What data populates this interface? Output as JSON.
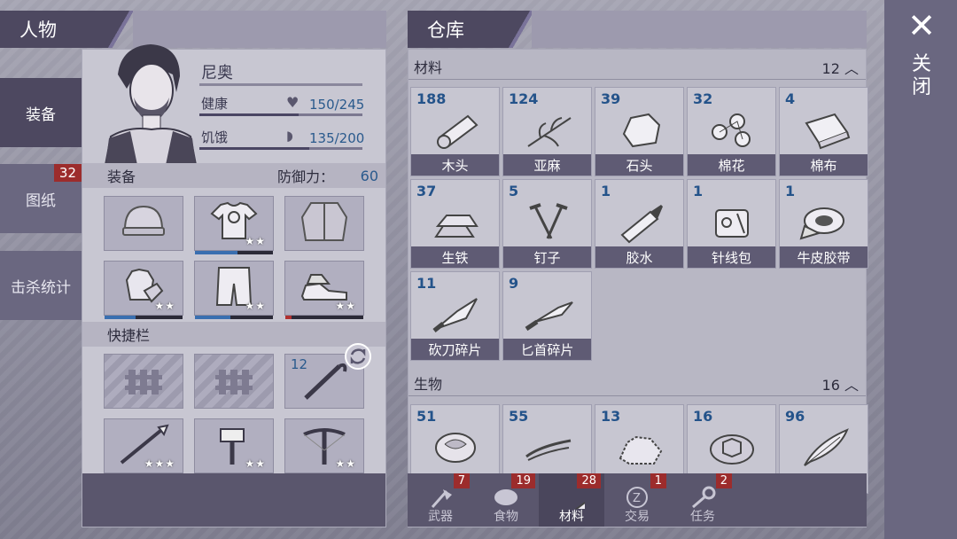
{
  "left_tabs": [
    {
      "label": "装备",
      "active": true
    },
    {
      "label": "图纸",
      "badge": "32"
    },
    {
      "label": "击杀统计"
    }
  ],
  "character": {
    "header": "人物",
    "name": "尼奥",
    "health_label": "健康",
    "health_value": "150/245",
    "health_fraction": 0.61,
    "hunger_label": "饥饿",
    "hunger_value": "135/200",
    "hunger_fraction": 0.675,
    "equipment_label": "装备",
    "defense_label": "防御力：",
    "defense_value": "60",
    "equipment_slots": [
      {
        "icon": "beanie-icon",
        "stars": 0
      },
      {
        "icon": "tshirt-icon",
        "stars": 2,
        "durability": 0.55,
        "dur_color": "#3a6fb0"
      },
      {
        "icon": "jacket-icon",
        "stars": 0
      },
      {
        "icon": "gloves-icon",
        "stars": 2,
        "durability": 0.4,
        "dur_color": "#3a6fb0"
      },
      {
        "icon": "pants-icon",
        "stars": 2,
        "durability": 0.45,
        "dur_color": "#3a6fb0"
      },
      {
        "icon": "sneakers-icon",
        "stars": 2,
        "durability": 0.08,
        "dur_color": "#b03030"
      }
    ],
    "hotbar_label": "快捷栏",
    "hotbar_slots": [
      {
        "icon": "locked-icon",
        "locked": true
      },
      {
        "icon": "locked-icon",
        "locked": true
      },
      {
        "icon": "crowbar-icon",
        "qty": "12"
      },
      {
        "icon": "spear-icon",
        "stars": 3,
        "durability": 0.05,
        "dur_color": "#b03030"
      },
      {
        "icon": "hammer-icon",
        "stars": 2,
        "durability": 0.4,
        "dur_color": "#3a6fb0"
      },
      {
        "icon": "crossbow-icon",
        "stars": 2,
        "durability": 0.15,
        "dur_color": "#b03030"
      }
    ]
  },
  "warehouse": {
    "header": "仓库",
    "materials": {
      "label": "材料",
      "count": "12",
      "items": [
        {
          "qty": "188",
          "name": "木头",
          "icon": "log-icon"
        },
        {
          "qty": "124",
          "name": "亚麻",
          "icon": "flax-icon"
        },
        {
          "qty": "39",
          "name": "石头",
          "icon": "stone-icon"
        },
        {
          "qty": "32",
          "name": "棉花",
          "icon": "cotton-icon"
        },
        {
          "qty": "4",
          "name": "棉布",
          "icon": "cloth-icon"
        },
        {
          "qty": "37",
          "name": "生铁",
          "icon": "iron-ingot-icon"
        },
        {
          "qty": "5",
          "name": "钉子",
          "icon": "nails-icon"
        },
        {
          "qty": "1",
          "name": "胶水",
          "icon": "glue-icon"
        },
        {
          "qty": "1",
          "name": "针线包",
          "icon": "sewing-kit-icon"
        },
        {
          "qty": "1",
          "name": "牛皮胶带",
          "icon": "duct-tape-icon"
        },
        {
          "qty": "11",
          "name": "砍刀碎片",
          "icon": "machete-shard-icon"
        },
        {
          "qty": "9",
          "name": "匕首碎片",
          "icon": "dagger-shard-icon"
        }
      ]
    },
    "creatures": {
      "label": "生物",
      "count": "16",
      "items": [
        {
          "qty": "51",
          "icon": "meat-icon"
        },
        {
          "qty": "55",
          "icon": "sinew-icon"
        },
        {
          "qty": "13",
          "icon": "fur-icon"
        },
        {
          "qty": "16",
          "icon": "turtle-shell-icon"
        },
        {
          "qty": "96",
          "icon": "feather-icon"
        }
      ]
    },
    "bottom_tabs": [
      {
        "label": "武器",
        "badge": "7",
        "icon": "axe-icon"
      },
      {
        "label": "食物",
        "badge": "19",
        "icon": "steak-icon"
      },
      {
        "label": "材料",
        "badge": "28",
        "icon": "log-icon",
        "active": true
      },
      {
        "label": "交易",
        "badge": "1",
        "icon": "coin-icon"
      },
      {
        "label": "任务",
        "badge": "2",
        "icon": "key-icon"
      }
    ]
  },
  "close": {
    "label": "关闭",
    "glyph": "✕"
  }
}
